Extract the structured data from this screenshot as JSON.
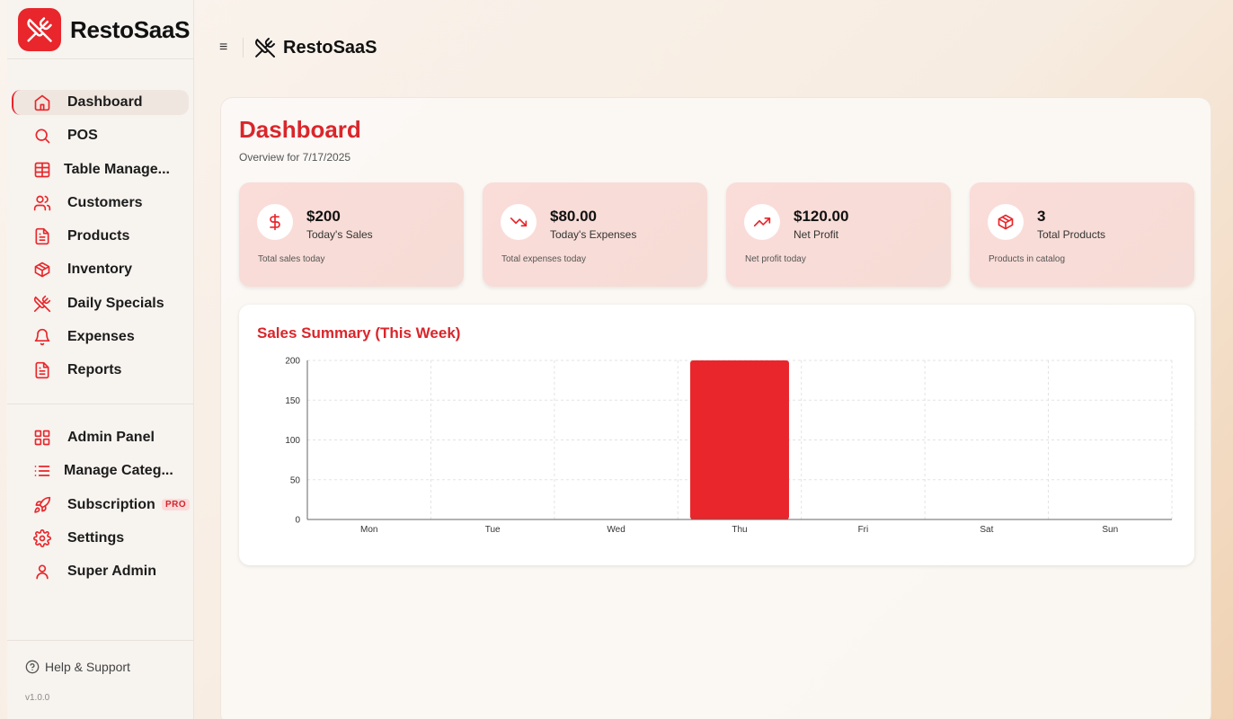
{
  "brand": {
    "name": "RestoSaaS",
    "icon": "utensils-crossed-icon",
    "accent": "#e8262b"
  },
  "sidebar": {
    "items": [
      {
        "label": "Dashboard",
        "icon": "home-icon",
        "active": true
      },
      {
        "label": "POS",
        "icon": "search-icon"
      },
      {
        "label": "Table Manage...",
        "icon": "table-icon"
      },
      {
        "label": "Customers",
        "icon": "users-icon"
      },
      {
        "label": "Products",
        "icon": "file-icon"
      },
      {
        "label": "Inventory",
        "icon": "box-icon"
      },
      {
        "label": "Daily Specials",
        "icon": "utensils-crossed-icon"
      },
      {
        "label": "Expenses",
        "icon": "bell-icon"
      },
      {
        "label": "Reports",
        "icon": "file-icon"
      }
    ],
    "admin_items": [
      {
        "label": "Admin Panel",
        "icon": "grid-icon"
      },
      {
        "label": "Manage Categ...",
        "icon": "list-icon"
      },
      {
        "label": "Subscription",
        "icon": "rocket-icon",
        "badge": "PRO"
      },
      {
        "label": "Settings",
        "icon": "gear-icon"
      },
      {
        "label": "Super Admin",
        "icon": "user-icon"
      }
    ],
    "help_label": "Help & Support",
    "version": "v1.0.0"
  },
  "topbar": {
    "menu_glyph": "≡",
    "title": "RestoSaaS"
  },
  "page": {
    "title": "Dashboard",
    "subtitle": "Overview for 7/17/2025"
  },
  "stats": [
    {
      "value": "$200",
      "label": "Today's Sales",
      "desc": "Total sales today",
      "icon": "dollar-icon"
    },
    {
      "value": "$80.00",
      "label": "Today's Expenses",
      "desc": "Total expenses today",
      "icon": "trending-down-icon"
    },
    {
      "value": "$120.00",
      "label": "Net Profit",
      "desc": "Net profit today",
      "icon": "trending-up-icon"
    },
    {
      "value": "3",
      "label": "Total Products",
      "desc": "Products in catalog",
      "icon": "box-icon"
    }
  ],
  "chart_data": {
    "type": "bar",
    "title": "Sales Summary (This Week)",
    "categories": [
      "Mon",
      "Tue",
      "Wed",
      "Thu",
      "Fri",
      "Sat",
      "Sun"
    ],
    "values": [
      0,
      0,
      0,
      200,
      0,
      0,
      0
    ],
    "yticks": [
      0,
      50,
      100,
      150,
      200
    ],
    "ylim": [
      0,
      200
    ],
    "grid": true,
    "color": "#e8262b"
  }
}
